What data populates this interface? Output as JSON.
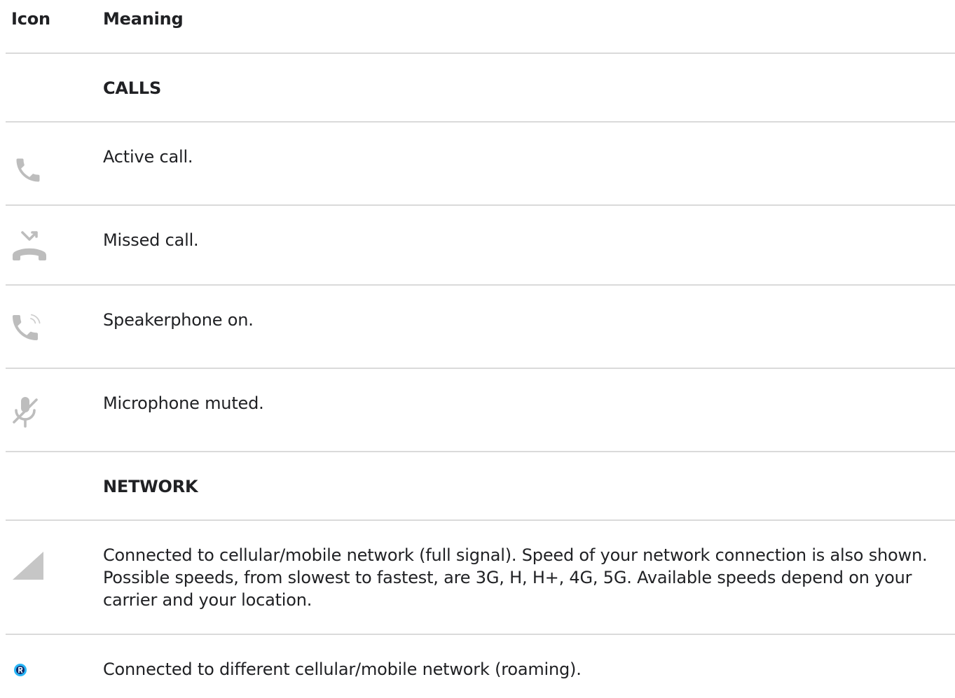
{
  "header": {
    "icon_col": "Icon",
    "meaning_col": "Meaning"
  },
  "rows": [
    {
      "type": "section",
      "label": "CALLS"
    },
    {
      "type": "item",
      "icon": "phone-icon",
      "text": "Active call."
    },
    {
      "type": "item",
      "icon": "missed-call-icon",
      "text": "Missed call."
    },
    {
      "type": "item",
      "icon": "speakerphone-icon",
      "text": "Speakerphone on."
    },
    {
      "type": "item",
      "icon": "mic-off-icon",
      "text": "Microphone muted."
    },
    {
      "type": "section",
      "label": "NETWORK"
    },
    {
      "type": "item",
      "icon": "cell-signal-icon",
      "text": "Connected to cellular/mobile network (full signal). Speed of your network connection is also shown. Possible speeds, from slowest to fastest, are 3G, H, H+, 4G, 5G. Available speeds depend on your carrier and your location."
    },
    {
      "type": "item",
      "icon": "roaming-icon",
      "text": "Connected to different cellular/mobile network (roaming)."
    }
  ],
  "colors": {
    "icon_gray": "#bdbdbd",
    "divider": "#dadada",
    "roaming_blue": "#29b6f6",
    "roaming_dark": "#1a237e"
  }
}
